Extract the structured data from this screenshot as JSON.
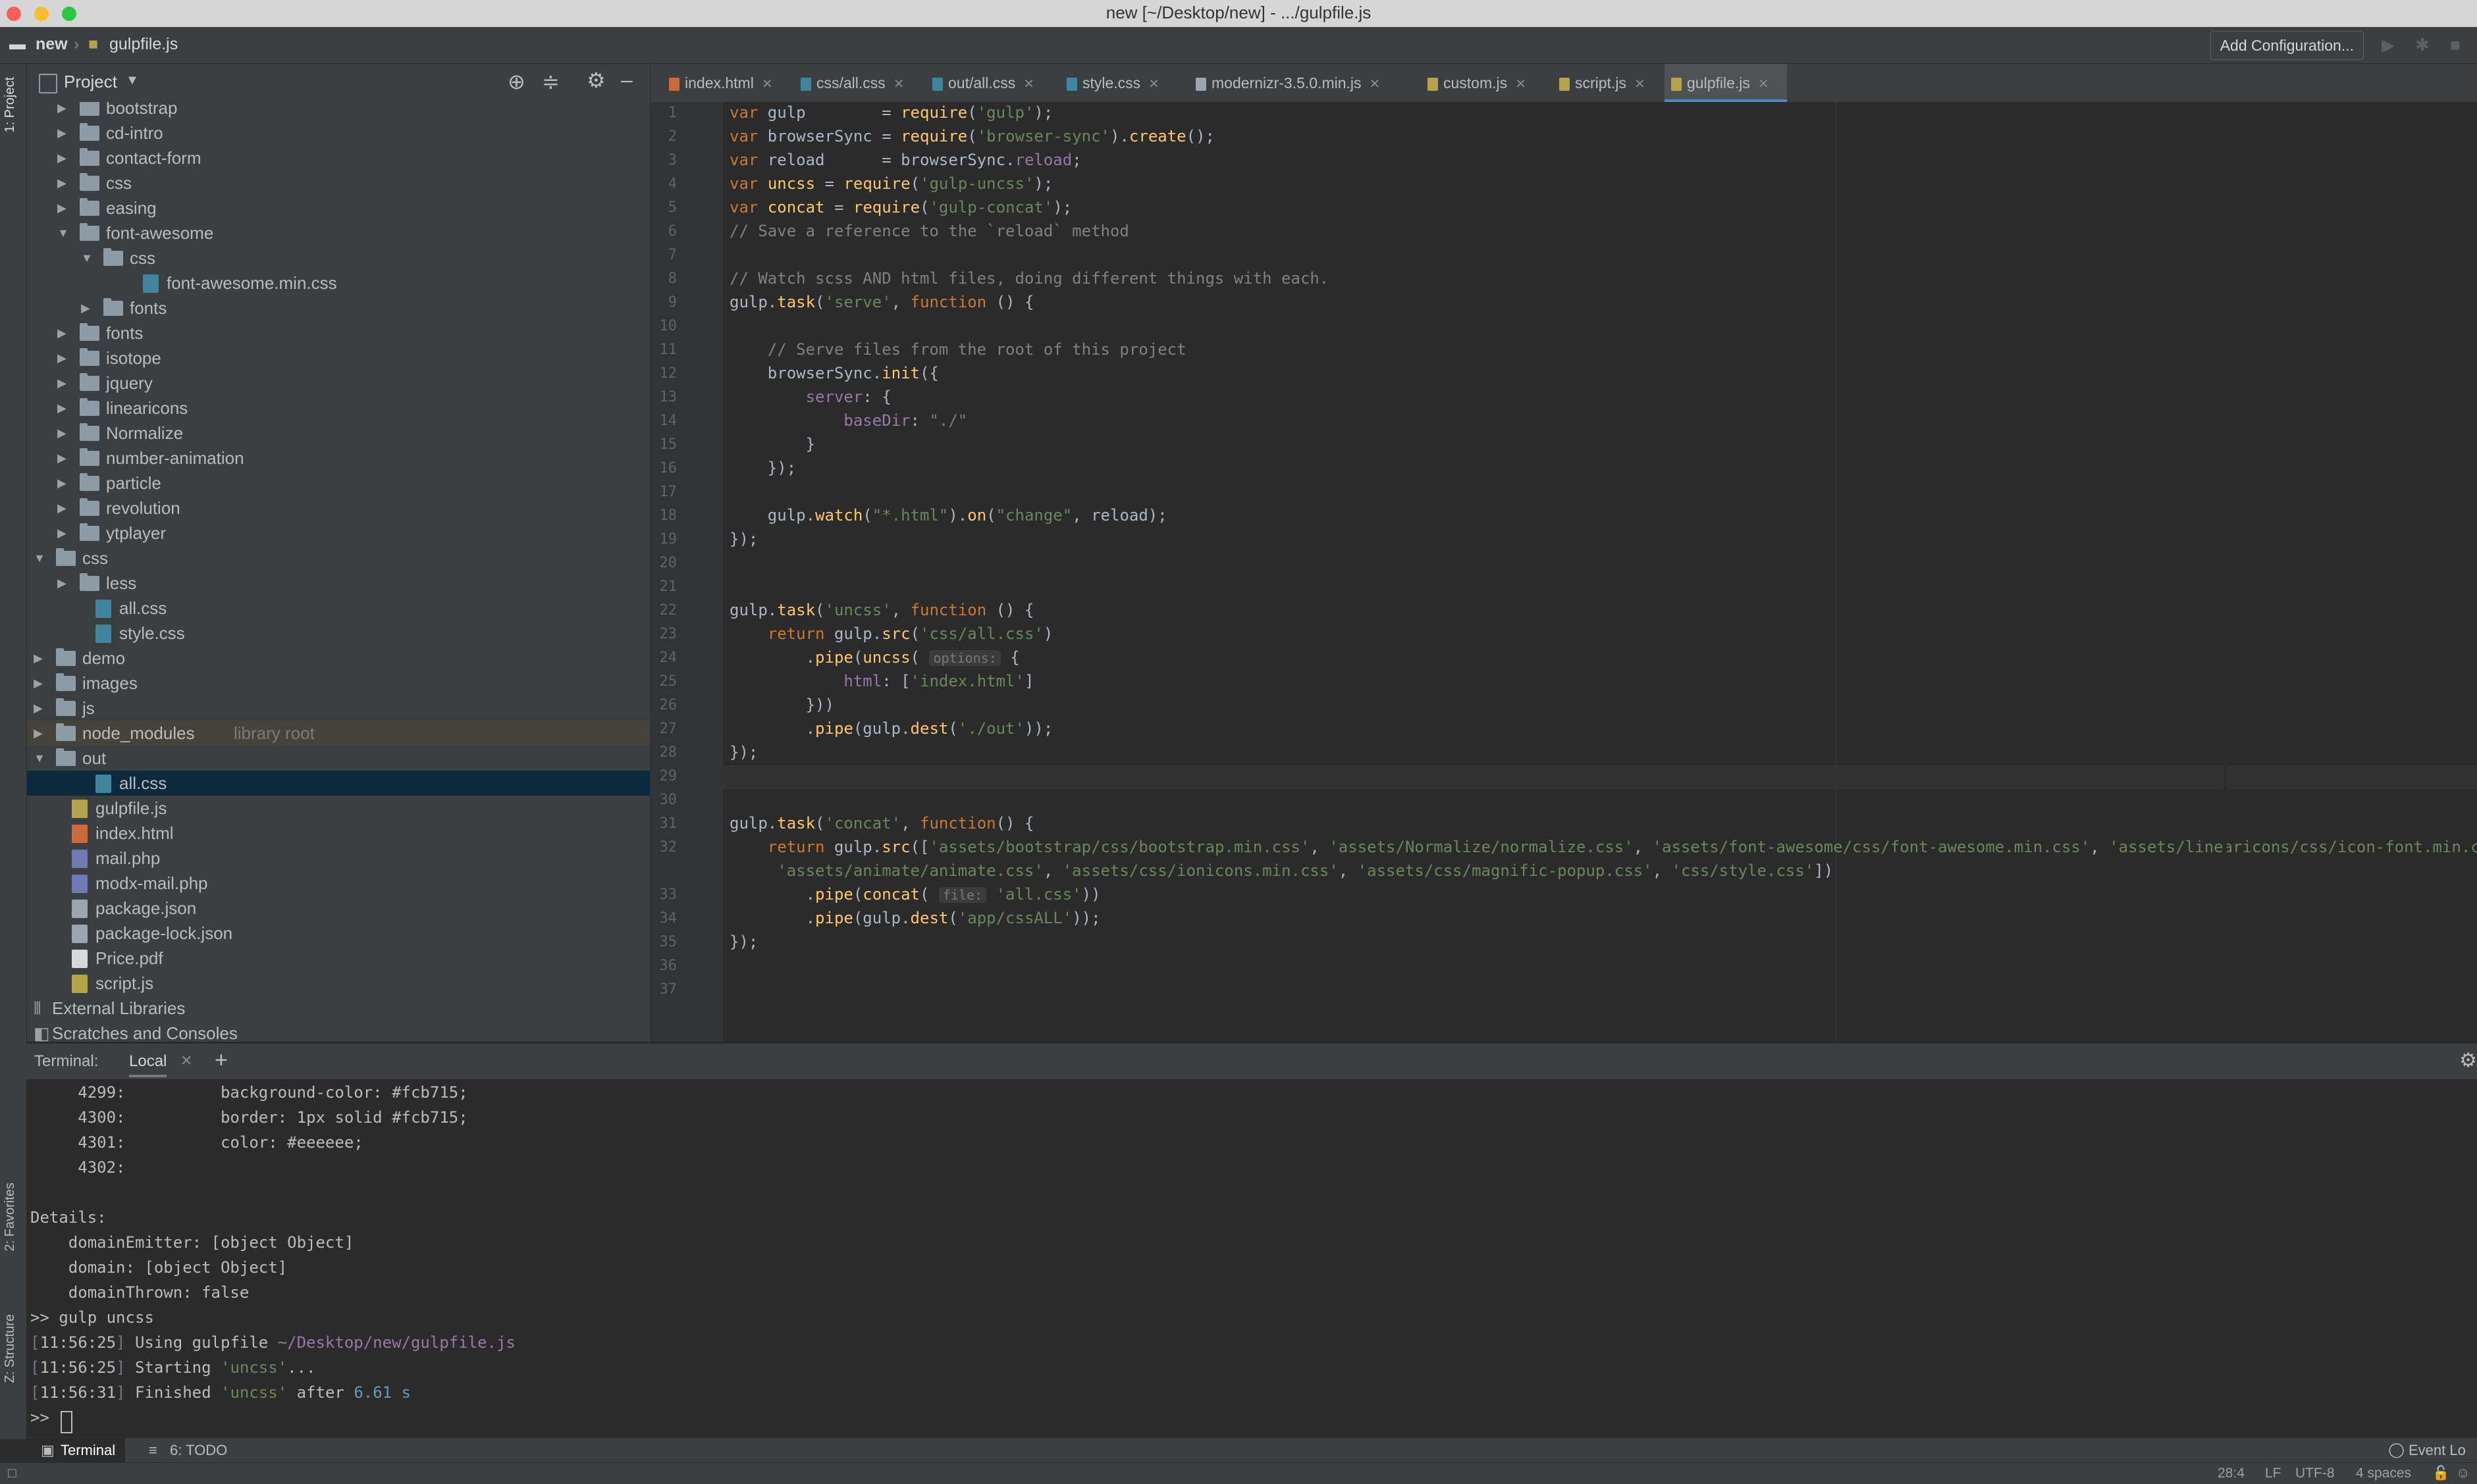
{
  "window": {
    "title": "new [~/Desktop/new] - .../gulpfile.js"
  },
  "navbar": {
    "project_name": "new",
    "file_name": "gulpfile.js",
    "add_config_label": "Add Configuration..."
  },
  "stripe": {
    "project_label": "1: Project",
    "favorites_label": "2: Favorites",
    "structure_label": "Z: Structure"
  },
  "project_panel": {
    "title": "Project",
    "tree": [
      {
        "label": "bootstrap",
        "depth": 2,
        "kind": "folder",
        "expanded": false
      },
      {
        "label": "cd-intro",
        "depth": 2,
        "kind": "folder",
        "expanded": false
      },
      {
        "label": "contact-form",
        "depth": 2,
        "kind": "folder",
        "expanded": false
      },
      {
        "label": "css",
        "depth": 2,
        "kind": "folder",
        "expanded": false
      },
      {
        "label": "easing",
        "depth": 2,
        "kind": "folder",
        "expanded": false
      },
      {
        "label": "font-awesome",
        "depth": 2,
        "kind": "folder",
        "expanded": true
      },
      {
        "label": "css",
        "depth": 3,
        "kind": "folder",
        "expanded": true
      },
      {
        "label": "font-awesome.min.css",
        "depth": 5,
        "kind": "css"
      },
      {
        "label": "fonts",
        "depth": 3,
        "kind": "folder",
        "expanded": false
      },
      {
        "label": "fonts",
        "depth": 2,
        "kind": "folder",
        "expanded": false
      },
      {
        "label": "isotope",
        "depth": 2,
        "kind": "folder",
        "expanded": false
      },
      {
        "label": "jquery",
        "depth": 2,
        "kind": "folder",
        "expanded": false
      },
      {
        "label": "linearicons",
        "depth": 2,
        "kind": "folder",
        "expanded": false
      },
      {
        "label": "Normalize",
        "depth": 2,
        "kind": "folder",
        "expanded": false
      },
      {
        "label": "number-animation",
        "depth": 2,
        "kind": "folder",
        "expanded": false
      },
      {
        "label": "particle",
        "depth": 2,
        "kind": "folder",
        "expanded": false
      },
      {
        "label": "revolution",
        "depth": 2,
        "kind": "folder",
        "expanded": false
      },
      {
        "label": "ytplayer",
        "depth": 2,
        "kind": "folder",
        "expanded": false
      },
      {
        "label": "css",
        "depth": 1,
        "kind": "folder",
        "expanded": true
      },
      {
        "label": "less",
        "depth": 2,
        "kind": "folder",
        "expanded": false
      },
      {
        "label": "all.css",
        "depth": 3,
        "kind": "css"
      },
      {
        "label": "style.css",
        "depth": 3,
        "kind": "css"
      },
      {
        "label": "demo",
        "depth": 1,
        "kind": "folder",
        "expanded": false
      },
      {
        "label": "images",
        "depth": 1,
        "kind": "folder",
        "expanded": false
      },
      {
        "label": "js",
        "depth": 1,
        "kind": "folder",
        "expanded": false
      },
      {
        "label": "node_modules",
        "depth": 1,
        "kind": "folder",
        "expanded": false,
        "hint": "library root"
      },
      {
        "label": "out",
        "depth": 1,
        "kind": "folder",
        "expanded": true
      },
      {
        "label": "all.css",
        "depth": 3,
        "kind": "css",
        "selected": true
      },
      {
        "label": "gulpfile.js",
        "depth": 2,
        "kind": "js"
      },
      {
        "label": "index.html",
        "depth": 2,
        "kind": "html"
      },
      {
        "label": "mail.php",
        "depth": 2,
        "kind": "php"
      },
      {
        "label": "modx-mail.php",
        "depth": 2,
        "kind": "php"
      },
      {
        "label": "package.json",
        "depth": 2,
        "kind": "json"
      },
      {
        "label": "package-lock.json",
        "depth": 2,
        "kind": "json"
      },
      {
        "label": "Price.pdf",
        "depth": 2,
        "kind": "pdf"
      },
      {
        "label": "script.js",
        "depth": 2,
        "kind": "js"
      },
      {
        "label": "External Libraries",
        "depth": 1,
        "kind": "lib"
      },
      {
        "label": "Scratches and Consoles",
        "depth": 1,
        "kind": "scratch"
      }
    ]
  },
  "tabs": [
    {
      "label": "index.html",
      "active": false
    },
    {
      "label": "css/all.css",
      "active": false
    },
    {
      "label": "out/all.css",
      "active": false
    },
    {
      "label": "style.css",
      "active": false
    },
    {
      "label": "modernizr-3.5.0.min.js",
      "active": false
    },
    {
      "label": "custom.js",
      "active": false
    },
    {
      "label": "script.js",
      "active": false
    },
    {
      "label": "gulpfile.js",
      "active": true
    }
  ],
  "editor": {
    "current_line": 28,
    "lines": [
      [
        [
          "kw",
          "var"
        ],
        [
          "t",
          " gulp        = "
        ],
        [
          "fn",
          "require"
        ],
        [
          "t",
          "("
        ],
        [
          "str",
          "'gulp'"
        ],
        [
          "t",
          ");"
        ]
      ],
      [
        [
          "kw",
          "var"
        ],
        [
          "t",
          " browserSync = "
        ],
        [
          "fn",
          "require"
        ],
        [
          "t",
          "("
        ],
        [
          "str",
          "'browser-sync'"
        ],
        [
          "t",
          ")."
        ],
        [
          "fn",
          "create"
        ],
        [
          "t",
          "();"
        ]
      ],
      [
        [
          "kw",
          "var"
        ],
        [
          "t",
          " reload      = browserSync."
        ],
        [
          "prop",
          "reload"
        ],
        [
          "t",
          ";"
        ]
      ],
      [
        [
          "kw",
          "var"
        ],
        [
          "t",
          " "
        ],
        [
          "fn",
          "uncss"
        ],
        [
          "t",
          " = "
        ],
        [
          "fn",
          "require"
        ],
        [
          "t",
          "("
        ],
        [
          "str",
          "'gulp-uncss'"
        ],
        [
          "t",
          ");"
        ]
      ],
      [
        [
          "kw",
          "var"
        ],
        [
          "t",
          " "
        ],
        [
          "fn",
          "concat"
        ],
        [
          "t",
          " = "
        ],
        [
          "fn",
          "require"
        ],
        [
          "t",
          "("
        ],
        [
          "str",
          "'gulp-concat'"
        ],
        [
          "t",
          ");"
        ]
      ],
      [
        [
          "cm",
          "// Save a reference to the `reload` method"
        ]
      ],
      [],
      [
        [
          "cm",
          "// Watch scss AND html files, doing different things with each."
        ]
      ],
      [
        [
          "t",
          "gulp."
        ],
        [
          "fn",
          "task"
        ],
        [
          "t",
          "("
        ],
        [
          "str",
          "'serve'"
        ],
        [
          "t",
          ", "
        ],
        [
          "kw",
          "function"
        ],
        [
          "t",
          " () {"
        ]
      ],
      [],
      [
        [
          "cm",
          "    // Serve files from the root of this project"
        ]
      ],
      [
        [
          "t",
          "    browserSync."
        ],
        [
          "fn",
          "init"
        ],
        [
          "t",
          "({"
        ]
      ],
      [
        [
          "prop",
          "        server"
        ],
        [
          "t",
          ": {"
        ]
      ],
      [
        [
          "prop",
          "            baseDir"
        ],
        [
          "t",
          ": "
        ],
        [
          "str",
          "\"./\""
        ]
      ],
      [
        [
          "t",
          "        }"
        ]
      ],
      [
        [
          "t",
          "    });"
        ]
      ],
      [],
      [
        [
          "t",
          "    gulp."
        ],
        [
          "fn",
          "watch"
        ],
        [
          "t",
          "("
        ],
        [
          "str",
          "\"*.html\""
        ],
        [
          "t",
          ")."
        ],
        [
          "fn",
          "on"
        ],
        [
          "t",
          "("
        ],
        [
          "str",
          "\"change\""
        ],
        [
          "t",
          ", reload);"
        ]
      ],
      [
        [
          "t",
          "});"
        ]
      ],
      [],
      [],
      [
        [
          "t",
          "gulp."
        ],
        [
          "fn",
          "task"
        ],
        [
          "t",
          "("
        ],
        [
          "str",
          "'uncss'"
        ],
        [
          "t",
          ", "
        ],
        [
          "kw",
          "function"
        ],
        [
          "t",
          " () {"
        ]
      ],
      [
        [
          "kw",
          "    return"
        ],
        [
          "t",
          " gulp."
        ],
        [
          "fn",
          "src"
        ],
        [
          "t",
          "("
        ],
        [
          "str",
          "'css/all.css'"
        ],
        [
          "t",
          ")"
        ]
      ],
      [
        [
          "t",
          "        ."
        ],
        [
          "fn",
          "pipe"
        ],
        [
          "t",
          "("
        ],
        [
          "fn",
          "uncss"
        ],
        [
          "t",
          "( "
        ],
        [
          "hint",
          "options:"
        ],
        [
          "t",
          " {"
        ]
      ],
      [
        [
          "prop",
          "            html"
        ],
        [
          "t",
          ": ["
        ],
        [
          "str",
          "'index.html'"
        ],
        [
          "t",
          "]"
        ]
      ],
      [
        [
          "t",
          "        }))"
        ]
      ],
      [
        [
          "t",
          "        ."
        ],
        [
          "fn",
          "pipe"
        ],
        [
          "t",
          "(gulp."
        ],
        [
          "fn",
          "dest"
        ],
        [
          "t",
          "("
        ],
        [
          "str",
          "'./out'"
        ],
        [
          "t",
          "));"
        ]
      ],
      [
        [
          "t",
          "});"
        ]
      ],
      [],
      [],
      [
        [
          "t",
          "gulp."
        ],
        [
          "fn",
          "task"
        ],
        [
          "t",
          "("
        ],
        [
          "str",
          "'concat'"
        ],
        [
          "t",
          ", "
        ],
        [
          "kw",
          "function"
        ],
        [
          "t",
          "() {"
        ]
      ],
      [
        [
          "kw",
          "    return"
        ],
        [
          "t",
          " gulp."
        ],
        [
          "fn",
          "src"
        ],
        [
          "t",
          "(["
        ],
        [
          "str",
          "'assets/bootstrap/css/bootstrap.min.css'"
        ],
        [
          "t",
          ", "
        ],
        [
          "str",
          "'assets/Normalize/normalize.css'"
        ],
        [
          "t",
          ", "
        ],
        [
          "str",
          "'assets/font-awesome/css/font-awesome.min.css'"
        ],
        [
          "t",
          ", "
        ],
        [
          "str",
          "'assets/linearicons/css/icon-font.min.css'"
        ],
        [
          "t",
          ","
        ]
      ],
      [
        [
          "t",
          "     "
        ],
        [
          "str",
          "'assets/animate/animate.css'"
        ],
        [
          "t",
          ", "
        ],
        [
          "str",
          "'assets/css/ionicons.min.css'"
        ],
        [
          "t",
          ", "
        ],
        [
          "str",
          "'assets/css/magnific-popup.css'"
        ],
        [
          "t",
          ", "
        ],
        [
          "str",
          "'css/style.css'"
        ],
        [
          "t",
          "])"
        ]
      ],
      [
        [
          "t",
          "        ."
        ],
        [
          "fn",
          "pipe"
        ],
        [
          "t",
          "("
        ],
        [
          "fn",
          "concat"
        ],
        [
          "t",
          "( "
        ],
        [
          "hint",
          "file:"
        ],
        [
          "t",
          " "
        ],
        [
          "str",
          "'all.css'"
        ],
        [
          "t",
          "))"
        ]
      ],
      [
        [
          "t",
          "        ."
        ],
        [
          "fn",
          "pipe"
        ],
        [
          "t",
          "(gulp."
        ],
        [
          "fn",
          "dest"
        ],
        [
          "t",
          "("
        ],
        [
          "str",
          "'app/cssALL'"
        ],
        [
          "t",
          "));"
        ]
      ],
      [
        [
          "t",
          "});"
        ]
      ],
      [],
      []
    ],
    "line_numbers": [
      "1",
      "2",
      "3",
      "4",
      "5",
      "6",
      "7",
      "8",
      "9",
      "10",
      "11",
      "12",
      "13",
      "14",
      "15",
      "16",
      "17",
      "18",
      "19",
      "20",
      "21",
      "22",
      "23",
      "24",
      "25",
      "26",
      "27",
      "28",
      "29",
      "30",
      "31",
      "32",
      "",
      "33",
      "34",
      "35",
      "36",
      "37"
    ]
  },
  "terminal": {
    "title": "Terminal:",
    "tab_label": "Local",
    "lines": [
      [
        [
          "t",
          "     4299:          background-color: #fcb715;"
        ]
      ],
      [
        [
          "t",
          "     4300:          border: 1px solid #fcb715;"
        ]
      ],
      [
        [
          "t",
          "     4301:          color: #eeeeee;"
        ]
      ],
      [
        [
          "t",
          "     4302:"
        ]
      ],
      [],
      [
        [
          "t",
          "Details:"
        ]
      ],
      [
        [
          "t",
          "    domainEmitter: [object Object]"
        ]
      ],
      [
        [
          "t",
          "    domain: [object Object]"
        ]
      ],
      [
        [
          "t",
          "    domainThrown: false"
        ]
      ],
      [
        [
          "t",
          ">> gulp uncss"
        ]
      ],
      [
        [
          "dim",
          "["
        ],
        [
          "t",
          "11:56:25"
        ],
        [
          "dim",
          "]"
        ],
        [
          "t",
          " Using gulpfile "
        ],
        [
          "path",
          "~/Desktop/new/gulpfile.js"
        ]
      ],
      [
        [
          "dim",
          "["
        ],
        [
          "t",
          "11:56:25"
        ],
        [
          "dim",
          "]"
        ],
        [
          "t",
          " Starting "
        ],
        [
          "str",
          "'uncss'"
        ],
        [
          "t",
          "..."
        ]
      ],
      [
        [
          "dim",
          "["
        ],
        [
          "t",
          "11:56:31"
        ],
        [
          "dim",
          "]"
        ],
        [
          "t",
          " Finished "
        ],
        [
          "str",
          "'uncss'"
        ],
        [
          "t",
          " after "
        ],
        [
          "num",
          "6.61 s"
        ]
      ],
      [
        [
          "t",
          ">> "
        ]
      ]
    ]
  },
  "bottom_tools": {
    "terminal_label": "Terminal",
    "todo_label": "6: TODO",
    "event_log_label": "Event Lo"
  },
  "status": {
    "position": "28:4",
    "line_sep": "LF",
    "encoding": "UTF-8",
    "indent": "4 spaces"
  },
  "colors": {
    "accent": "#4a88c7",
    "selection": "#0d293e",
    "keyword": "#cc7832",
    "string": "#6a8759",
    "function": "#ffc66d"
  }
}
